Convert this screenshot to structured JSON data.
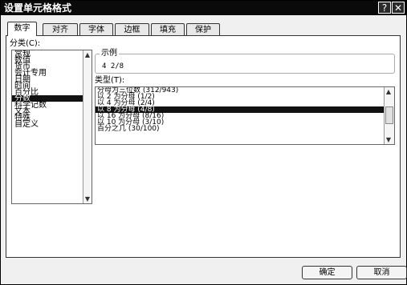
{
  "window": {
    "title": "设置单元格格式",
    "help_label": "?",
    "close_label": "✕"
  },
  "tabs": [
    {
      "label": "数字"
    },
    {
      "label": "对齐"
    },
    {
      "label": "字体"
    },
    {
      "label": "边框"
    },
    {
      "label": "填充"
    },
    {
      "label": "保护"
    }
  ],
  "active_tab": "数字",
  "category": {
    "label": "分类(C):",
    "items": [
      {
        "label": "常规"
      },
      {
        "label": "数值"
      },
      {
        "label": "货币"
      },
      {
        "label": "会计专用"
      },
      {
        "label": "日期"
      },
      {
        "label": "时间"
      },
      {
        "label": "百分比"
      },
      {
        "label": "分数"
      },
      {
        "label": "科学记数"
      },
      {
        "label": "文本"
      },
      {
        "label": "特殊"
      },
      {
        "label": "自定义"
      }
    ],
    "selected": "分数"
  },
  "sample": {
    "label": "示例",
    "value": "4 2/8"
  },
  "type": {
    "label": "类型(T):",
    "items": [
      {
        "label": "分母为三位数 (312/943)"
      },
      {
        "label": "以 2 为分母 (1/2)"
      },
      {
        "label": "以 4 为分母 (2/4)"
      },
      {
        "label": "以 8 为分母 (4/8)"
      },
      {
        "label": "以 16 为分母 (8/16)"
      },
      {
        "label": "以 10 为分母 (3/10)"
      },
      {
        "label": "百分之几 (30/100)"
      }
    ],
    "selected": "以 8 为分母 (4/8)"
  },
  "buttons": {
    "ok": "确定",
    "cancel": "取消"
  },
  "colors": {
    "titlebar": "#0a0a0a",
    "selection": "#111111",
    "panel": "#ffffff"
  },
  "icons": {
    "scroll_up": "▲",
    "scroll_down": "▼"
  }
}
